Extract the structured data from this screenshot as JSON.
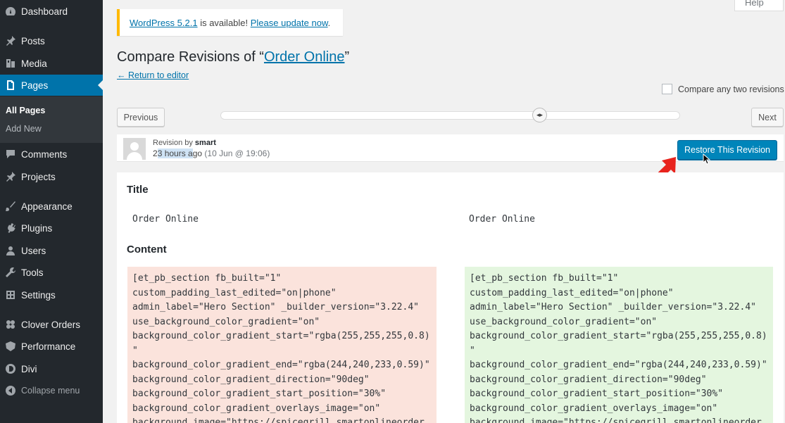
{
  "sidebar": {
    "items": [
      {
        "label": "Dashboard",
        "icon": "dashboard-icon"
      },
      {
        "label": "Posts",
        "icon": "pushpin-icon"
      },
      {
        "label": "Media",
        "icon": "media-icon"
      },
      {
        "label": "Pages",
        "icon": "pages-icon"
      },
      {
        "label": "Comments",
        "icon": "comments-icon"
      },
      {
        "label": "Projects",
        "icon": "pushpin-icon"
      },
      {
        "label": "Appearance",
        "icon": "brush-icon"
      },
      {
        "label": "Plugins",
        "icon": "plugin-icon"
      },
      {
        "label": "Users",
        "icon": "users-icon"
      },
      {
        "label": "Tools",
        "icon": "wrench-icon"
      },
      {
        "label": "Settings",
        "icon": "settings-icon"
      },
      {
        "label": "Clover Orders",
        "icon": "clover-icon"
      },
      {
        "label": "Performance",
        "icon": "performance-icon"
      },
      {
        "label": "Divi",
        "icon": "divi-icon"
      },
      {
        "label": "Collapse menu",
        "icon": "collapse-icon"
      }
    ],
    "submenu": [
      "All Pages",
      "Add New"
    ],
    "active": "Pages"
  },
  "help_tab": "Help",
  "notice": {
    "version_link": "WordPress 5.2.1",
    "middle_text": " is available! ",
    "update_link": "Please update now",
    "end_text": "."
  },
  "heading": {
    "prefix": "Compare Revisions of “",
    "page_link": "Order Online",
    "suffix": "”"
  },
  "return_link": "← Return to editor",
  "compare_two_label": "Compare any two revisions",
  "buttons": {
    "previous": "Previous",
    "next": "Next",
    "restore": "Restore This Revision"
  },
  "slider_position": 0.7,
  "revision": {
    "author_prefix": "Revision by ",
    "author": "smart",
    "time_prefix": "2",
    "time_highlight": "3 hours a",
    "time_suffix": "go ",
    "date": "(10 Jun @ 19:06)"
  },
  "diff": {
    "title_heading": "Title",
    "title_left": "Order Online",
    "title_right": "Order Online",
    "content_heading": "Content",
    "content_left": [
      "[et_pb_section fb_built=\"1\"",
      "custom_padding_last_edited=\"on|phone\"",
      "admin_label=\"Hero Section\" _builder_version=\"3.22.4\"",
      "use_background_color_gradient=\"on\"",
      "background_color_gradient_start=\"rgba(255,255,255,0.8)",
      "\"",
      "background_color_gradient_end=\"rgba(244,240,233,0.59)\"",
      "background_color_gradient_direction=\"90deg\"",
      "background_color_gradient_start_position=\"30%\"",
      "background_color_gradient_overlays_image=\"on\"",
      "background_image=\"https://spicegrill.smartonlineorder"
    ],
    "content_right": [
      "[et_pb_section fb_built=\"1\"",
      "custom_padding_last_edited=\"on|phone\"",
      "admin_label=\"Hero Section\" _builder_version=\"3.22.4\"",
      "use_background_color_gradient=\"on\"",
      "background_color_gradient_start=\"rgba(255,255,255,0.8)",
      "\"",
      "background_color_gradient_end=\"rgba(244,240,233,0.59)\"",
      "background_color_gradient_direction=\"90deg\"",
      "background_color_gradient_start_position=\"30%\"",
      "background_color_gradient_overlays_image=\"on\"",
      "background_image=\"https://spicegrill.smartonlineorder"
    ]
  },
  "colors": {
    "sidebar_bg": "#23282d",
    "accent": "#0073aa",
    "removed_bg": "#fbe3dc",
    "added_bg": "#e4f6df",
    "annotation_arrow": "#e8231d"
  }
}
